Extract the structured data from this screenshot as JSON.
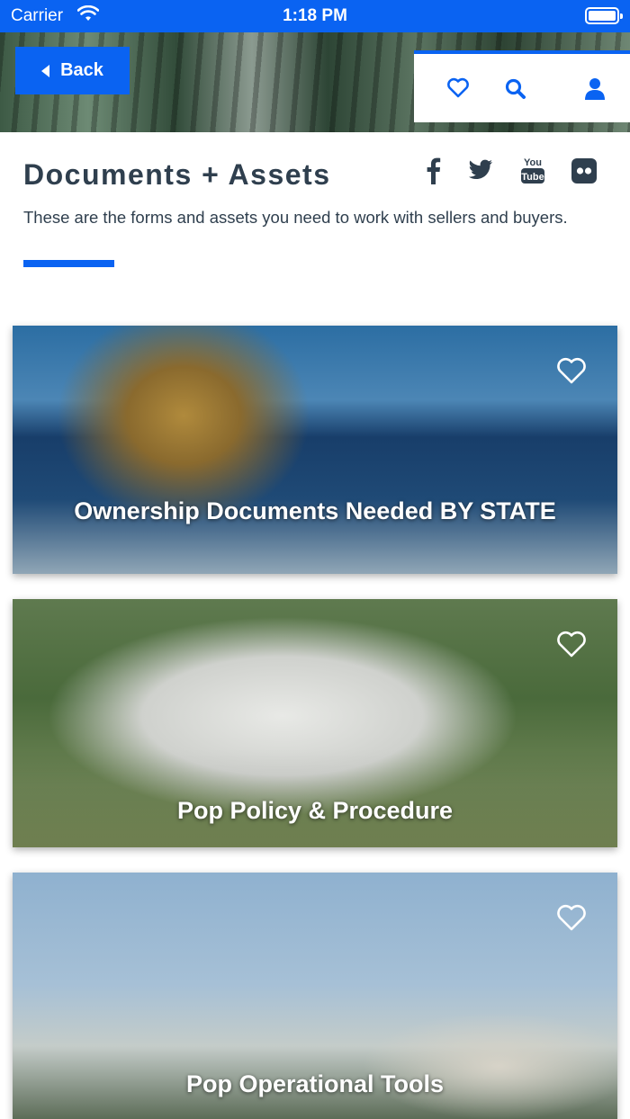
{
  "status_bar": {
    "carrier": "Carrier",
    "time": "1:18 PM"
  },
  "header": {
    "back_label": "Back",
    "icons": [
      "heart-icon",
      "search-icon",
      "user-icon"
    ],
    "accent_color": "#0a63f2"
  },
  "page": {
    "title": "Documents + Assets",
    "subtitle": "These are the forms and assets you need to work with sellers and buyers.",
    "social_icons": [
      "facebook-icon",
      "twitter-icon",
      "youtube-icon",
      "flickr-icon"
    ]
  },
  "cards": [
    {
      "title": "Ownership Documents Needed BY STATE",
      "favorite": false
    },
    {
      "title": "Pop Policy & Procedure",
      "favorite": false
    },
    {
      "title": "Pop Operational Tools",
      "favorite": false
    }
  ],
  "colors": {
    "primary": "#0a63f2",
    "text": "#2f3f4e"
  }
}
